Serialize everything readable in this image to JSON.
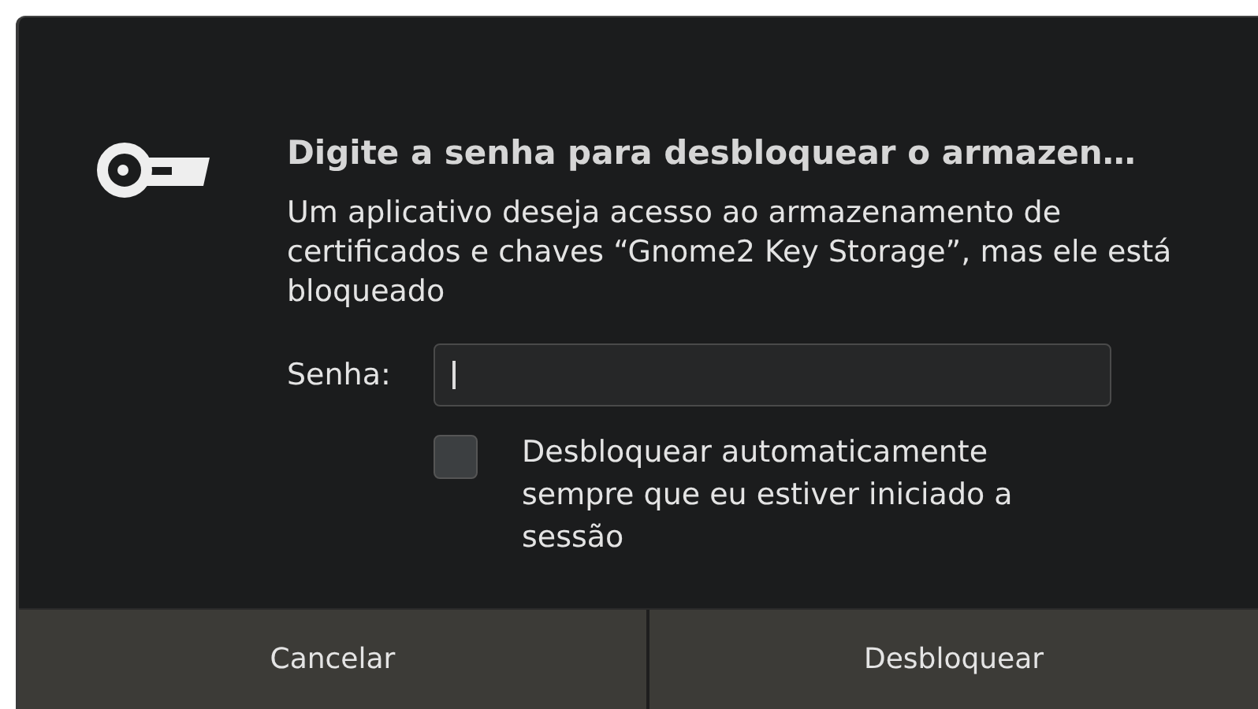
{
  "dialog": {
    "title": "Digite a senha para desbloquear o armazen…",
    "message": "Um aplicativo deseja acesso ao armazenamento de certificados e chaves “Gnome2 Key Storage”, mas ele está bloqueado",
    "password": {
      "label": "Senha:"
    },
    "auto_unlock": {
      "label": "Desbloquear automaticamente sempre que eu estiver iniciado a sessão",
      "checked": false
    },
    "buttons": [
      {
        "label": "Cancelar"
      },
      {
        "label": "Desbloquear"
      }
    ]
  }
}
